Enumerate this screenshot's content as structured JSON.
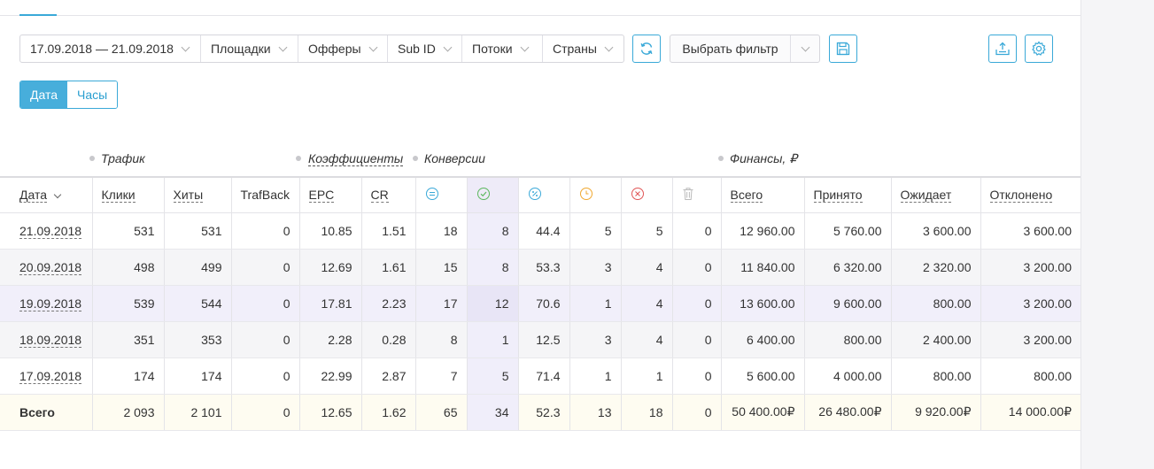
{
  "filters": {
    "date_range": "17.09.2018 — 21.09.2018",
    "platforms": "Площадки",
    "offers": "Офферы",
    "sub_id": "Sub ID",
    "streams": "Потоки",
    "countries": "Страны",
    "choose_filter": "Выбрать фильтр"
  },
  "icons": {
    "refresh": "refresh-icon",
    "save": "save-icon",
    "export": "export-icon",
    "settings": "gear-icon"
  },
  "toggle": {
    "date": "Дата",
    "hours": "Часы",
    "active": "date"
  },
  "groups": {
    "traffic": "Трафик",
    "coefficients": "Коэффициенты",
    "conversions": "Конверсии",
    "finance": "Финансы, ₽"
  },
  "columns": {
    "date": "Дата",
    "clicks": "Клики",
    "hits": "Хиты",
    "trafback": "TrafBack",
    "epc": "EPC",
    "cr": "CR",
    "total": "Всего",
    "accepted": "Принято",
    "pending": "Ожидает",
    "rejected": "Отклонено"
  },
  "colors": {
    "accent": "#3aa9d8",
    "conv_total_icon": "#3aa9d8",
    "conv_approved_icon": "#5bb85d",
    "conv_percent_icon": "#3aa9d8",
    "conv_pending_icon": "#f0a830",
    "conv_rejected_icon": "#e05555",
    "conv_trash_icon": "#bbbbbb"
  },
  "rows": [
    {
      "date": "21.09.2018",
      "clicks": "531",
      "hits": "531",
      "trafback": "0",
      "epc": "10.85",
      "cr": "1.51",
      "conv_total": "18",
      "conv_approved": "8",
      "conv_percent": "44.4",
      "conv_pending": "5",
      "conv_rejected": "5",
      "conv_trash": "0",
      "fin_total": "12 960.00",
      "fin_accepted": "5 760.00",
      "fin_pending": "3 600.00",
      "fin_rejected": "3 600.00"
    },
    {
      "date": "20.09.2018",
      "clicks": "498",
      "hits": "499",
      "trafback": "0",
      "epc": "12.69",
      "cr": "1.61",
      "conv_total": "15",
      "conv_approved": "8",
      "conv_percent": "53.3",
      "conv_pending": "3",
      "conv_rejected": "4",
      "conv_trash": "0",
      "fin_total": "11 840.00",
      "fin_accepted": "6 320.00",
      "fin_pending": "2 320.00",
      "fin_rejected": "3 200.00"
    },
    {
      "date": "19.09.2018",
      "clicks": "539",
      "hits": "544",
      "trafback": "0",
      "epc": "17.81",
      "cr": "2.23",
      "conv_total": "17",
      "conv_approved": "12",
      "conv_percent": "70.6",
      "conv_pending": "1",
      "conv_rejected": "4",
      "conv_trash": "0",
      "fin_total": "13 600.00",
      "fin_accepted": "9 600.00",
      "fin_pending": "800.00",
      "fin_rejected": "3 200.00"
    },
    {
      "date": "18.09.2018",
      "clicks": "351",
      "hits": "353",
      "trafback": "0",
      "epc": "2.28",
      "cr": "0.28",
      "conv_total": "8",
      "conv_approved": "1",
      "conv_percent": "12.5",
      "conv_pending": "3",
      "conv_rejected": "4",
      "conv_trash": "0",
      "fin_total": "6 400.00",
      "fin_accepted": "800.00",
      "fin_pending": "2 400.00",
      "fin_rejected": "3 200.00"
    },
    {
      "date": "17.09.2018",
      "clicks": "174",
      "hits": "174",
      "trafback": "0",
      "epc": "22.99",
      "cr": "2.87",
      "conv_total": "7",
      "conv_approved": "5",
      "conv_percent": "71.4",
      "conv_pending": "1",
      "conv_rejected": "1",
      "conv_trash": "0",
      "fin_total": "5 600.00",
      "fin_accepted": "4 000.00",
      "fin_pending": "800.00",
      "fin_rejected": "800.00"
    }
  ],
  "total": {
    "label": "Всего",
    "clicks": "2 093",
    "hits": "2 101",
    "trafback": "0",
    "epc": "12.65",
    "cr": "1.62",
    "conv_total": "65",
    "conv_approved": "34",
    "conv_percent": "52.3",
    "conv_pending": "13",
    "conv_rejected": "18",
    "conv_trash": "0",
    "fin_total": "50 400.00₽",
    "fin_accepted": "26 480.00₽",
    "fin_pending": "9 920.00₽",
    "fin_rejected": "14 000.00₽"
  }
}
